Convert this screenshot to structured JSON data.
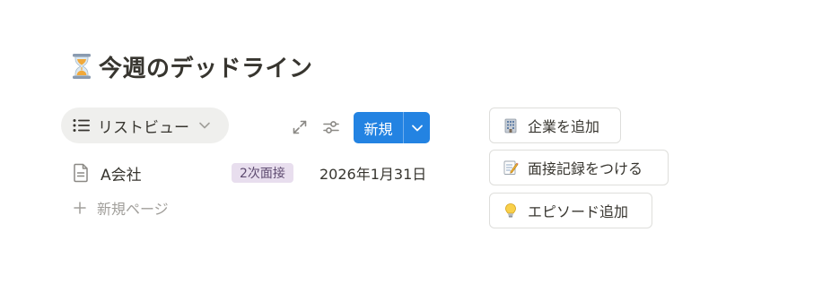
{
  "heading": {
    "title": "今週のデッドライン",
    "icon": "hourglass-icon"
  },
  "view": {
    "tab_label": "リストビュー",
    "icons": [
      "list-icon",
      "chevron-down-icon"
    ]
  },
  "toolbar": {
    "expand_icon": "expand-arrows-icon",
    "filter_icon": "sliders-icon",
    "new_label": "新規",
    "dropdown_icon": "chevron-down-icon",
    "accent": "#2383e2"
  },
  "rows": [
    {
      "title": "A会社",
      "tag": "2次面接",
      "tag_color": "#e8deee",
      "date": "2026年1月31日",
      "icon": "document-icon"
    }
  ],
  "new_page": {
    "label": "新規ページ",
    "icon": "plus-icon"
  },
  "actions": [
    {
      "label": "企業を追加",
      "icon": "office-building-icon"
    },
    {
      "label": "面接記録をつける",
      "icon": "memo-icon"
    },
    {
      "label": "エピソード追加",
      "icon": "light-bulb-icon"
    }
  ]
}
